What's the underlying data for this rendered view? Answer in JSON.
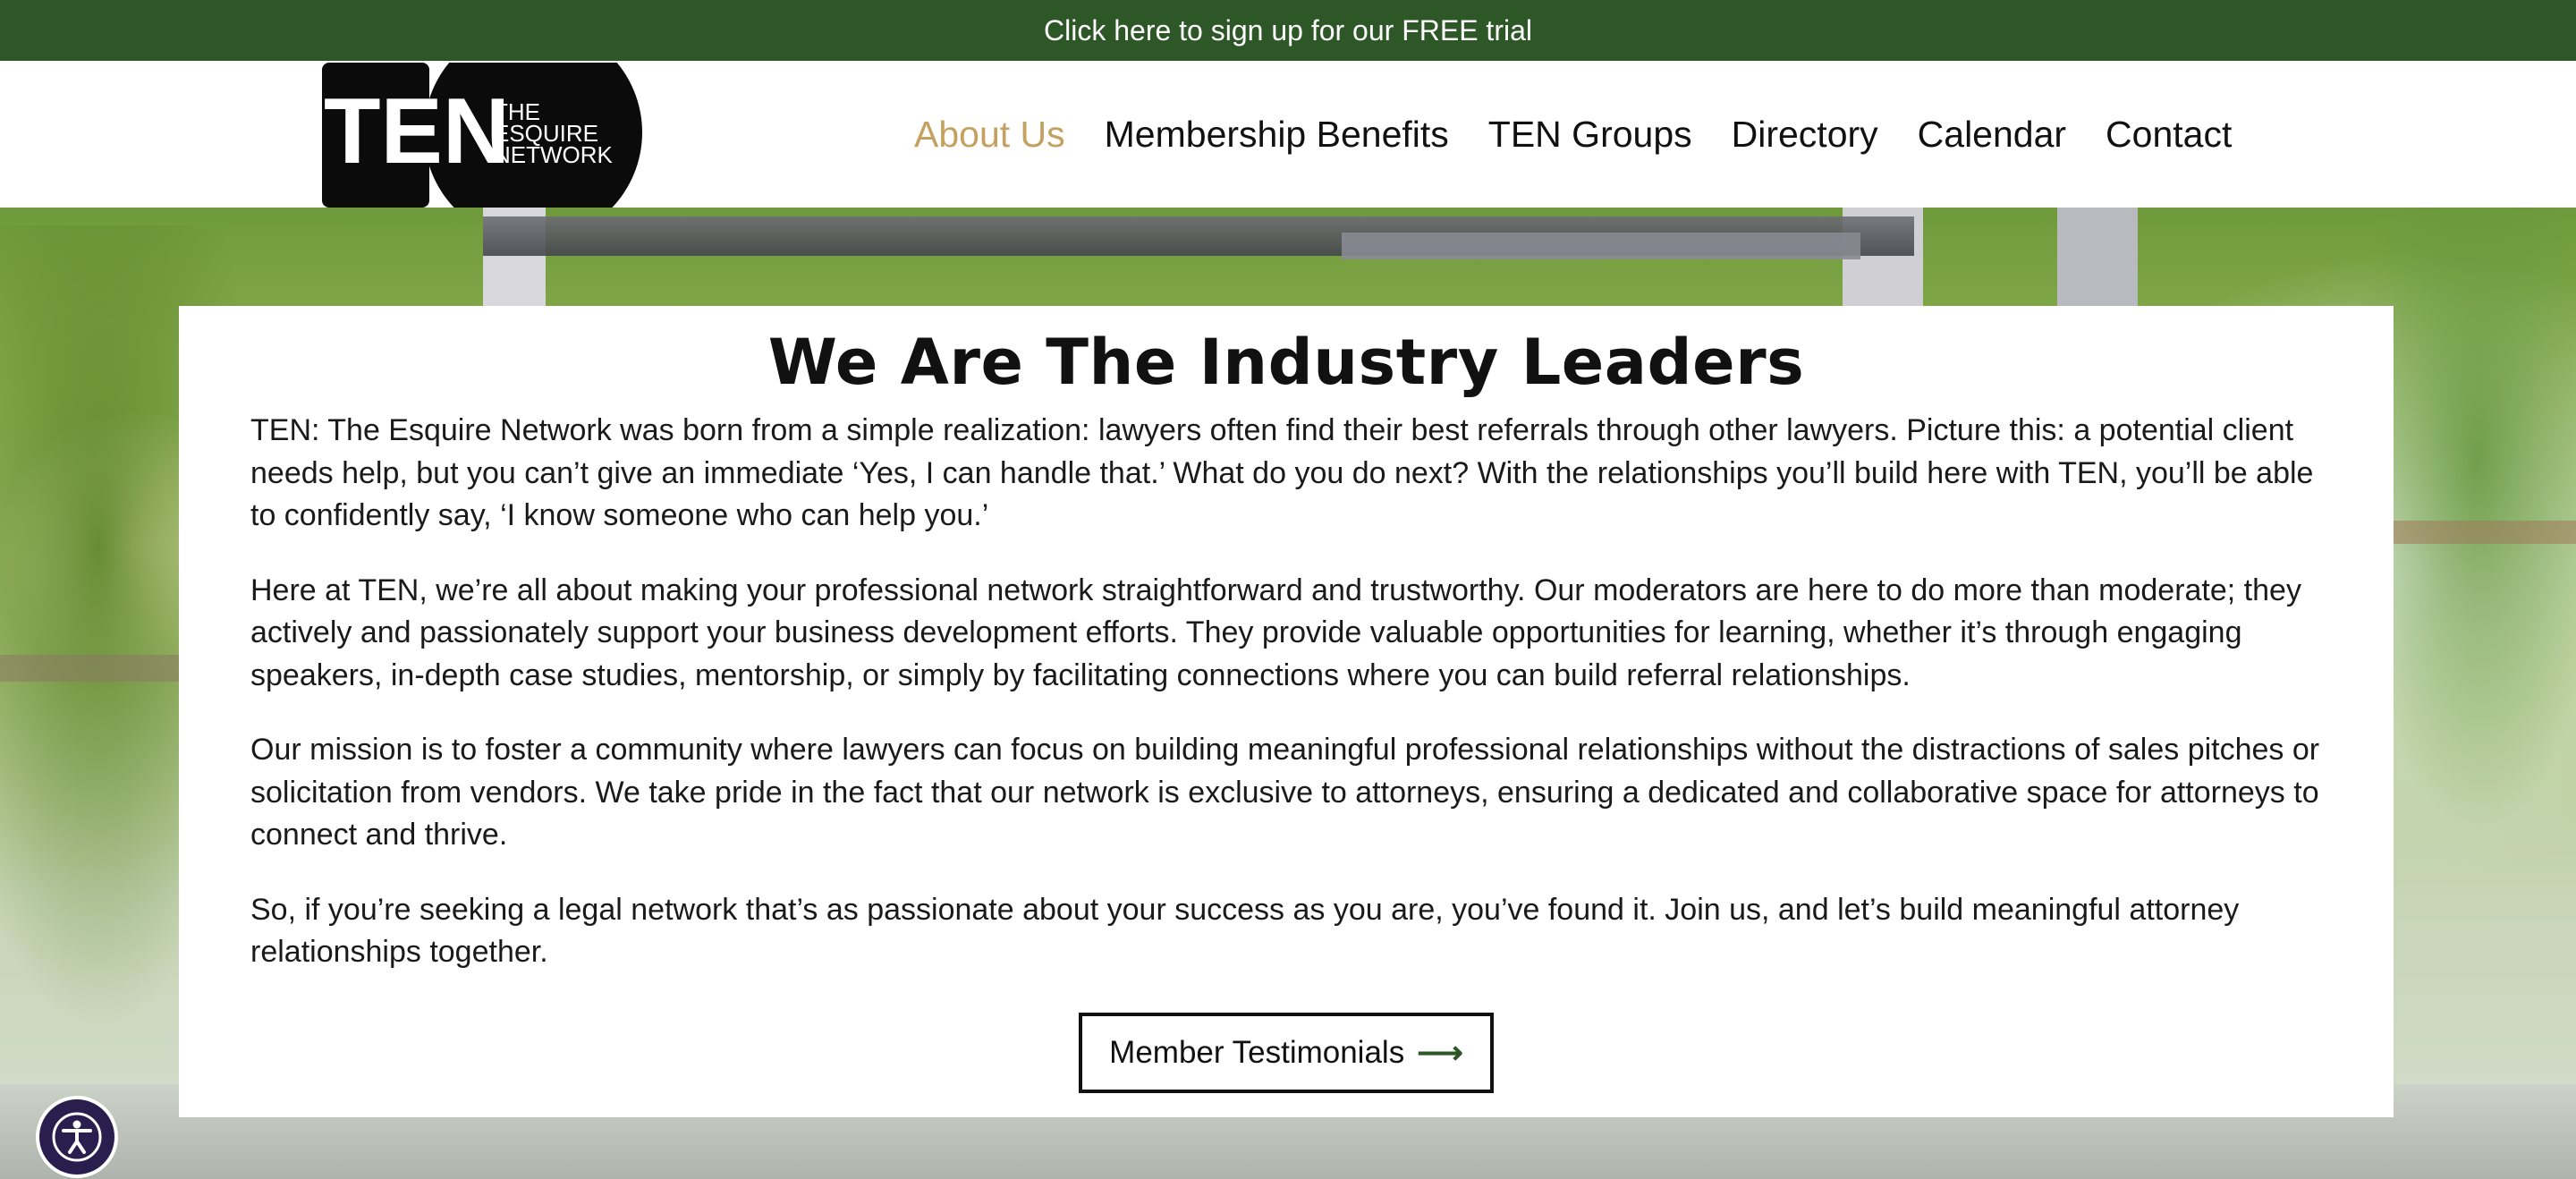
{
  "promo": {
    "text": "Click here to sign up for our FREE trial"
  },
  "logo": {
    "mark": "TEN",
    "line1": "THE",
    "line2": "ESQUIRE",
    "line3": "NETWORK"
  },
  "nav": {
    "items": [
      {
        "label": "About Us",
        "active": true
      },
      {
        "label": "Membership Benefits",
        "active": false
      },
      {
        "label": "TEN Groups",
        "active": false
      },
      {
        "label": "Directory",
        "active": false
      },
      {
        "label": "Calendar",
        "active": false
      },
      {
        "label": "Contact",
        "active": false
      }
    ]
  },
  "main": {
    "title": "We Are The Industry Leaders",
    "paragraphs": [
      "TEN: The Esquire Network was born from a simple realization: lawyers often find their best referrals through other lawyers. Picture this: a potential client needs help, but you can’t give an immediate ‘Yes, I can handle that.’ What do you do next? With the relationships you’ll build here with TEN, you’ll be able to confidently say, ‘I know someone who can help you.’",
      "Here at TEN, we’re all about making your professional network straightforward and trustworthy. Our moderators are here to do more than moderate; they actively and passionately support your business development efforts. They provide valuable opportunities for learning, whether it’s through engaging speakers, in-depth case studies, mentorship, or simply by facilitating connections where you can build referral relationships.",
      "Our mission is to foster a community where lawyers can focus on building meaningful professional relationships without the distractions of sales pitches or solicitation from vendors. We take pride in the fact that our network is exclusive to attorneys, ensuring a dedicated and collaborative space for attorneys to connect and thrive.",
      "So, if you’re seeking a legal network that’s as passionate about your success as you are, you’ve found it. Join us, and let’s build meaningful attorney relationships together."
    ],
    "button_label": "Member Testimonials",
    "button_icon": "arrow-right-icon"
  },
  "accessibility": {
    "icon": "accessibility-icon"
  },
  "colors": {
    "brand_green": "#2d5727",
    "nav_active": "#c4a160",
    "a11y_bg": "#2a1e4e"
  }
}
